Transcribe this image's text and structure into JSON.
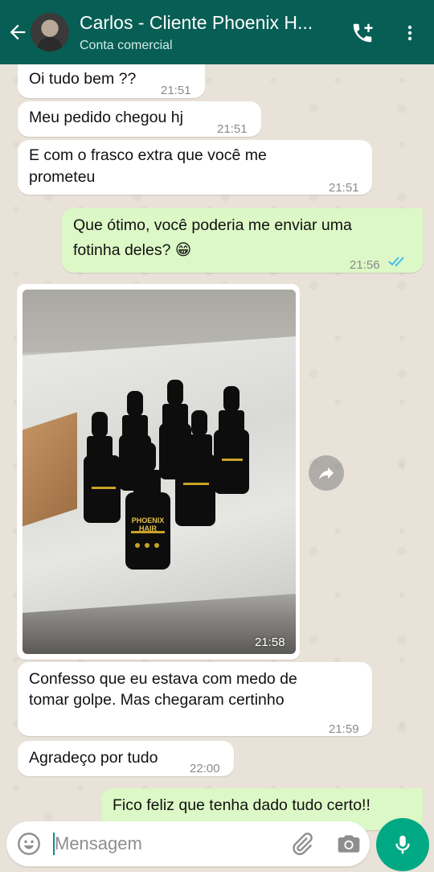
{
  "header": {
    "title": "Carlos - Cliente Phoenix  H...",
    "subtitle": "Conta comercial"
  },
  "messages": [
    {
      "direction": "in",
      "text": "Oi tudo bem ??",
      "time": "21:51"
    },
    {
      "direction": "in",
      "text": "Meu pedido chegou hj",
      "time": "21:51"
    },
    {
      "direction": "in",
      "text_line1": "E com o frasco extra que você me",
      "text_line2": "prometeu",
      "time": "21:51"
    },
    {
      "direction": "out",
      "text_line1": "Que ótimo, você poderia me enviar uma",
      "text_line2": "fotinha deles? 😁",
      "time": "21:56",
      "status": "read"
    },
    {
      "direction": "in",
      "type": "image",
      "time": "21:58",
      "image_labels": [
        "PHOENIX",
        "HAIR"
      ]
    },
    {
      "direction": "in",
      "text_line1": "Confesso que eu estava com medo de",
      "text_line2": "tomar golpe. Mas chegaram certinho",
      "time": "21:59"
    },
    {
      "direction": "in",
      "text": "Agradeço por tudo",
      "time": "22:00"
    },
    {
      "direction": "out",
      "text": "Fico feliz que tenha dado tudo certo!!"
    }
  ],
  "composer": {
    "placeholder": "Mensagem",
    "icons": [
      "emoji-icon",
      "paperclip-icon",
      "camera-icon",
      "microphone-icon"
    ]
  },
  "colors": {
    "header": "#075e54",
    "incoming_bubble": "#ffffff",
    "outgoing_bubble": "#dcf8c6",
    "read_ticks": "#34b7f1",
    "mic_button": "#00a884"
  }
}
